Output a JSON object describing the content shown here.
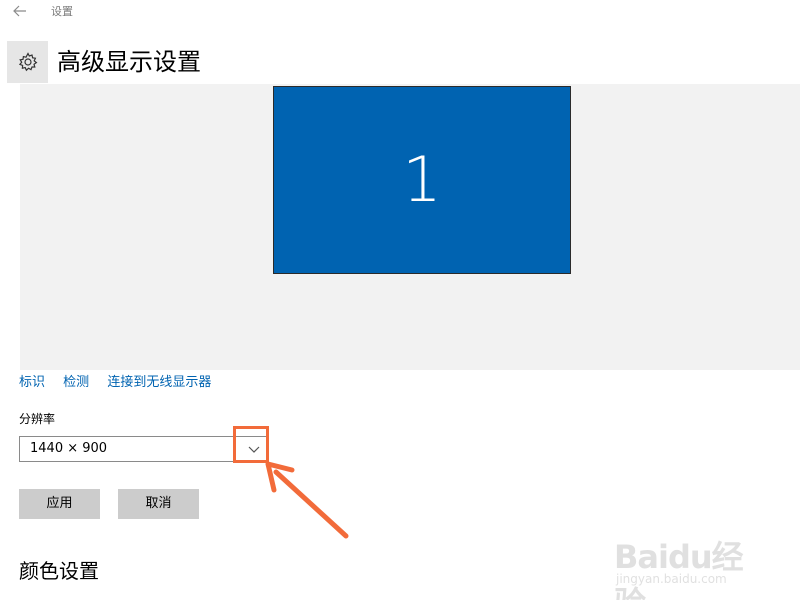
{
  "window": {
    "title": "设置"
  },
  "header": {
    "title": "高级显示设置",
    "icon": "gear-icon"
  },
  "display": {
    "monitor_label": "1",
    "monitor_color": "#0063b1"
  },
  "links": {
    "identify": "标识",
    "detect": "检测",
    "connect_wireless": "连接到无线显示器"
  },
  "resolution": {
    "label": "分辨率",
    "value": "1440 × 900"
  },
  "buttons": {
    "apply": "应用",
    "cancel": "取消"
  },
  "sections": {
    "color_settings": "颜色设置"
  },
  "annotation": {
    "color": "#f26b3a"
  },
  "watermark": {
    "brand": "Baidu经验",
    "url": "jingyan.baidu.com"
  }
}
